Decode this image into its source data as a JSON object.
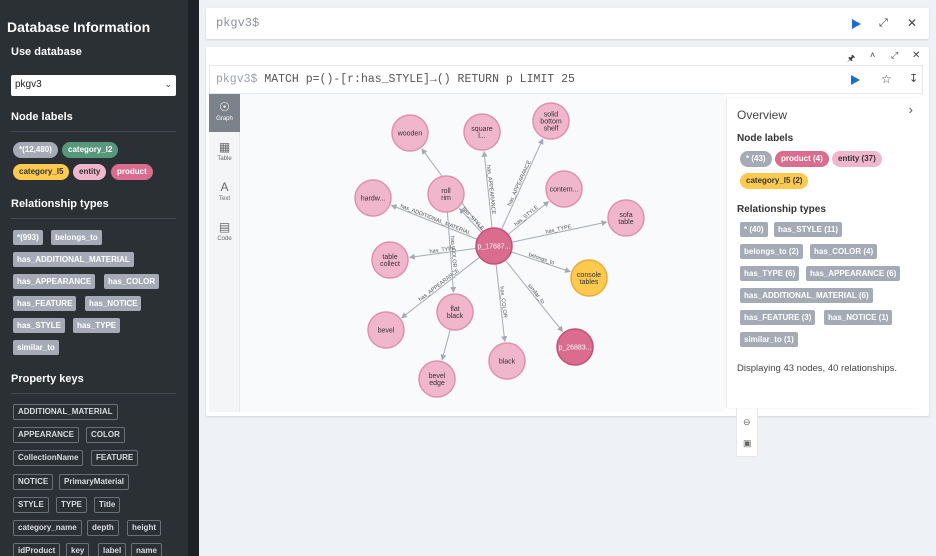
{
  "sidebar": {
    "title": "Database Information",
    "use_database_heading": "Use database",
    "selected_database": "pkgv3",
    "node_labels_heading": "Node labels",
    "node_labels": [
      "*(12,480)",
      "category_l2",
      "category_l5",
      "entity",
      "product"
    ],
    "relationship_types_heading": "Relationship types",
    "relationship_types": [
      "*(993)",
      "belongs_to",
      "has_ADDITIONAL_MATERIAL",
      "has_APPEARANCE",
      "has_COLOR",
      "has_FEATURE",
      "has_NOTICE",
      "has_STYLE",
      "has_TYPE",
      "similar_to"
    ],
    "property_keys_heading": "Property keys",
    "property_keys": [
      "ADDITIONAL_MATERIAL",
      "APPEARANCE",
      "COLOR",
      "CollectionName",
      "FEATURE",
      "NOTICE",
      "PrimaryMaterial",
      "STYLE",
      "TYPE",
      "Title",
      "category_name",
      "depth",
      "height",
      "idProduct",
      "key",
      "label",
      "name"
    ]
  },
  "editor": {
    "prompt": "pkgv3$"
  },
  "result": {
    "prompt": "pkgv3$",
    "query": "MATCH p=()-[r:has_STYLE]→() RETURN p LIMIT 25",
    "view_tabs": [
      "Graph",
      "Table",
      "Text",
      "Code"
    ],
    "overview": {
      "title": "Overview",
      "node_labels_heading": "Node labels",
      "node_labels": [
        "* (43)",
        "product (4)",
        "entity (37)",
        "category_l5 (2)"
      ],
      "relationship_types_heading": "Relationship types",
      "relationship_types": [
        "* (40)",
        "has_STYLE (11)",
        "belongs_to (2)",
        "has_COLOR (4)",
        "has_TYPE (6)",
        "has_APPEARANCE (6)",
        "has_ADDITIONAL_MATERIAL (6)",
        "has_FEATURE (3)",
        "has_NOTICE (1)",
        "similar_to (1)"
      ],
      "summary": "Displaying 43 nodes, 40 relationships."
    },
    "graph": {
      "nodes": [
        "wooden",
        "square l...",
        "solid bottom shelf",
        "roll rim",
        "hardw...",
        "contem...",
        "sofa table",
        "p_17687...",
        "table collect",
        "console tables",
        "flat black",
        "bevel",
        "black",
        "p_26883...",
        "bevel edge"
      ],
      "edges": [
        "has_AP...",
        "has_APPEARANCE",
        "has_APPEARANCE",
        "has_STYLE",
        "has_ADDITIONAL_MATERIAL",
        "has_STYLE",
        "has_TYPE",
        "has_TYPE",
        "belongs_to",
        "has_APPEARANCE",
        "has_COLOR",
        "has_COLOR",
        "similar_to"
      ]
    }
  },
  "colors": {
    "sidebar_bg": "#2b3035",
    "entity_node": "#f0b6cc",
    "product_node": "#d96c8f",
    "category_l5_node": "#fdc94e",
    "category_l2_pill": "#58987a",
    "star_pill": "#a5abb6",
    "accent_play": "#1a6fd0"
  }
}
